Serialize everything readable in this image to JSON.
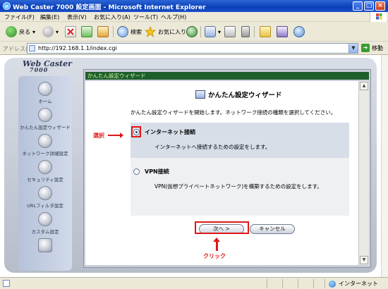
{
  "window": {
    "title": "Web Caster 7000 設定画面 - Microsoft Internet Explorer",
    "controls": {
      "minimize": "_",
      "maximize": "□",
      "close": "×"
    }
  },
  "menu": [
    "ファイル(F)",
    "編集(E)",
    "表示(V)",
    "お気に入り(A)",
    "ツール(T)",
    "ヘルプ(H)"
  ],
  "toolbar": {
    "back": "戻る",
    "search": "検索",
    "favorites": "お気に入り"
  },
  "address": {
    "label": "アドレス(D)",
    "url": "http://192.168.1.1/index.cgi",
    "go": "移動"
  },
  "device": {
    "brand": "Web Caster",
    "model": "7000"
  },
  "nav": [
    {
      "label": "ホーム",
      "icon": "home-icon"
    },
    {
      "label": "かんたん設定ウィザード",
      "icon": "wizard-icon"
    },
    {
      "label": "ネットワーク詳細設定",
      "icon": "network-icon"
    },
    {
      "label": "セキュリティ設定",
      "icon": "lock-icon"
    },
    {
      "label": "URLフィルタ設定",
      "icon": "filter-icon"
    },
    {
      "label": "カスタム設定",
      "icon": "custom-icon"
    },
    {
      "label": "",
      "icon": "blank-icon"
    }
  ],
  "panel": {
    "breadcrumb": "かんたん設定ウィザード",
    "title": "かんたん設定ウィザード",
    "intro": "かんたん設定ウィザードを開始します。ネットワーク接続の種類を選択してください。",
    "options": [
      {
        "label": "インターネット接続",
        "desc": "インターネットへ接続するための設定をします。",
        "selected": true
      },
      {
        "label": "VPN接続",
        "desc": "VPN(仮想プライベートネットワーク)を構築するための設定をします。",
        "selected": false
      }
    ],
    "next_button": "次へ >",
    "cancel_button": "キャンセル"
  },
  "annotations": {
    "select": "選択",
    "click": "クリック"
  },
  "status": {
    "zone": "インターネット"
  },
  "colors": {
    "annotation": "#e01818",
    "titlebar": "#0a3fb8",
    "breadcrumb_bg": "#1d5f2c"
  }
}
